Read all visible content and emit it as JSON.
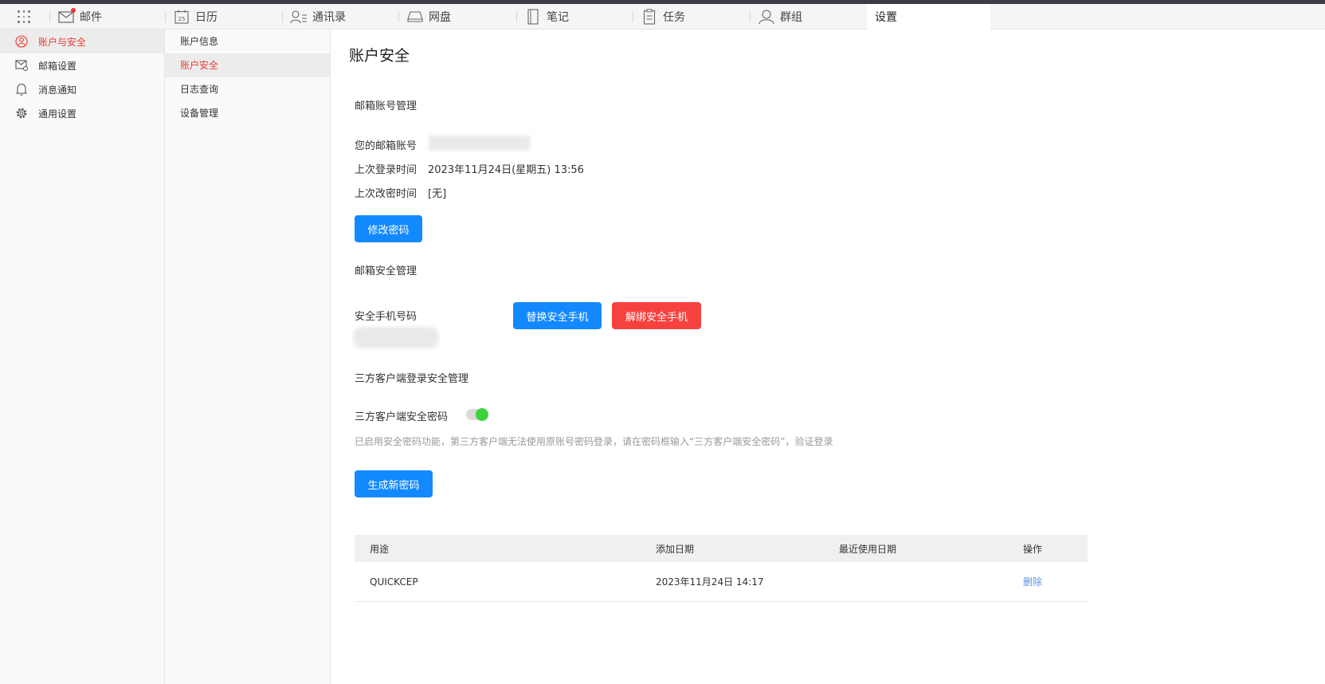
{
  "nav": {
    "tabs": [
      {
        "label": "邮件",
        "icon": "mail-icon",
        "badge": true
      },
      {
        "label": "日历",
        "icon": "calendar-icon",
        "icon_text": "25"
      },
      {
        "label": "通讯录",
        "icon": "contacts-icon"
      },
      {
        "label": "网盘",
        "icon": "drive-icon"
      },
      {
        "label": "笔记",
        "icon": "notes-icon"
      },
      {
        "label": "任务",
        "icon": "tasks-icon"
      },
      {
        "label": "群组",
        "icon": "groups-icon"
      },
      {
        "label": "设置",
        "active": true
      }
    ]
  },
  "sidebar": {
    "items": [
      {
        "label": "账户与安全",
        "icon": "user-icon",
        "active": true
      },
      {
        "label": "邮箱设置",
        "icon": "mail-settings-icon"
      },
      {
        "label": "消息通知",
        "icon": "bell-icon"
      },
      {
        "label": "通用设置",
        "icon": "gear-icon"
      }
    ]
  },
  "subnav": {
    "items": [
      {
        "label": "账户信息"
      },
      {
        "label": "账户安全",
        "active": true
      },
      {
        "label": "日志查询"
      },
      {
        "label": "设备管理"
      }
    ]
  },
  "main": {
    "title": "账户安全",
    "account_section": {
      "title": "邮箱账号管理",
      "email_label": "您的邮箱账号",
      "last_login_label": "上次登录时间",
      "last_login_value": "2023年11月24日(星期五) 13:56",
      "last_pwd_change_label": "上次改密时间",
      "last_pwd_change_value": "[无]",
      "change_password_button": "修改密码"
    },
    "security_section": {
      "title": "邮箱安全管理",
      "phone_label": "安全手机号码",
      "replace_phone_button": "替换安全手机",
      "unbind_phone_button": "解绑安全手机"
    },
    "third_party_section": {
      "title": "三方客户端登录安全管理",
      "toggle_label": "三方客户端安全密码",
      "toggle_on": true,
      "hint": "已启用安全密码功能，第三方客户端无法使用原账号密码登录，请在密码框输入“三方客户端安全密码”，验证登录",
      "generate_button": "生成新密码"
    },
    "table": {
      "headers": [
        "用途",
        "添加日期",
        "最近使用日期",
        "操作"
      ],
      "rows": [
        {
          "purpose": "QUICKCEP",
          "added": "2023年11月24日 14:17",
          "last_used": "",
          "action": "删除"
        }
      ]
    }
  },
  "colors": {
    "accent_red": "#ee3b36",
    "primary_blue": "#1389ff",
    "danger_red": "#f6423f",
    "toggle_green": "#3dd23c",
    "link_blue": "#5a90e8"
  }
}
